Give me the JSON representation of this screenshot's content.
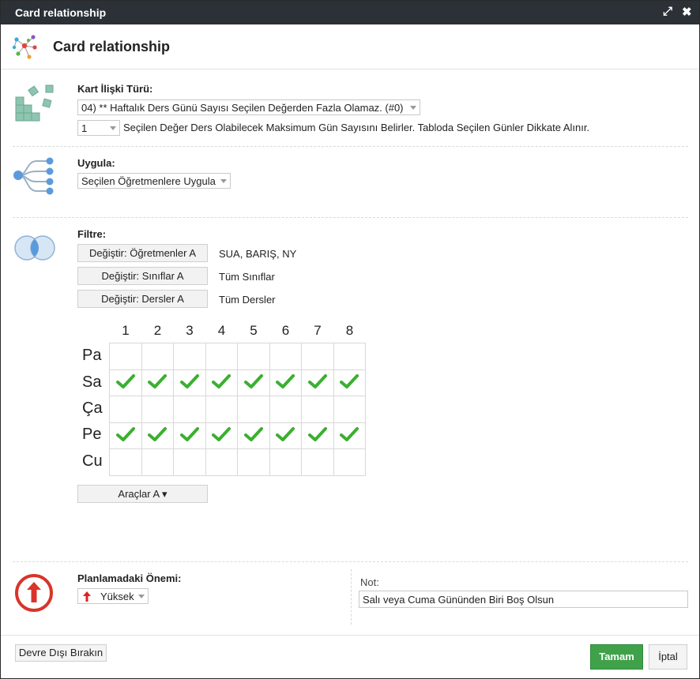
{
  "window": {
    "title": "Card relationship",
    "maximize_icon": "expand-icon",
    "close_icon": "close-icon"
  },
  "header": {
    "title": "Card relationship",
    "icon": "network-icon"
  },
  "relation_type": {
    "label": "Kart İlişki Türü:",
    "selected": "04) ** Haftalık Ders Günü Sayısı Seçilen Değerden Fazla Olamaz. (#0)",
    "count_value": "1",
    "description": "Seçilen Değer Ders Olabilecek Maksimum Gün Sayısını Belirler. Tabloda Seçilen Günler Dikkate Alınır."
  },
  "apply": {
    "label": "Uygula:",
    "selected": "Seçilen Öğretmenlere Uygula"
  },
  "filter": {
    "label": "Filtre:",
    "rows": [
      {
        "button": "Değiştir: Öğretmenler A",
        "value": "SUA, BARIŞ, NY"
      },
      {
        "button": "Değiştir: Sınıflar A",
        "value": "Tüm Sınıflar"
      },
      {
        "button": "Değiştir: Dersler A",
        "value": "Tüm Dersler"
      }
    ]
  },
  "schedule": {
    "periods": [
      "1",
      "2",
      "3",
      "4",
      "5",
      "6",
      "7",
      "8"
    ],
    "days": [
      "Pa",
      "Sa",
      "Ça",
      "Pe",
      "Cu"
    ],
    "checked": [
      [
        false,
        false,
        false,
        false,
        false,
        false,
        false,
        false
      ],
      [
        true,
        true,
        true,
        true,
        true,
        true,
        true,
        true
      ],
      [
        false,
        false,
        false,
        false,
        false,
        false,
        false,
        false
      ],
      [
        true,
        true,
        true,
        true,
        true,
        true,
        true,
        true
      ],
      [
        false,
        false,
        false,
        false,
        false,
        false,
        false,
        false
      ]
    ],
    "check_color": "#3ab02f",
    "tools_button": "Araçlar A ▾"
  },
  "importance": {
    "label": "Planlamadaki Önemi:",
    "selected": "Yüksek",
    "icon_color": "#d9342b"
  },
  "note": {
    "label": "Not:",
    "value": "Salı veya Cuma Gününden Biri Boş Olsun"
  },
  "footer": {
    "disable_button": "Devre Dışı Bırakın",
    "ok_button": "Tamam",
    "cancel_button": "İptal",
    "ok_color": "#3fa24a"
  }
}
